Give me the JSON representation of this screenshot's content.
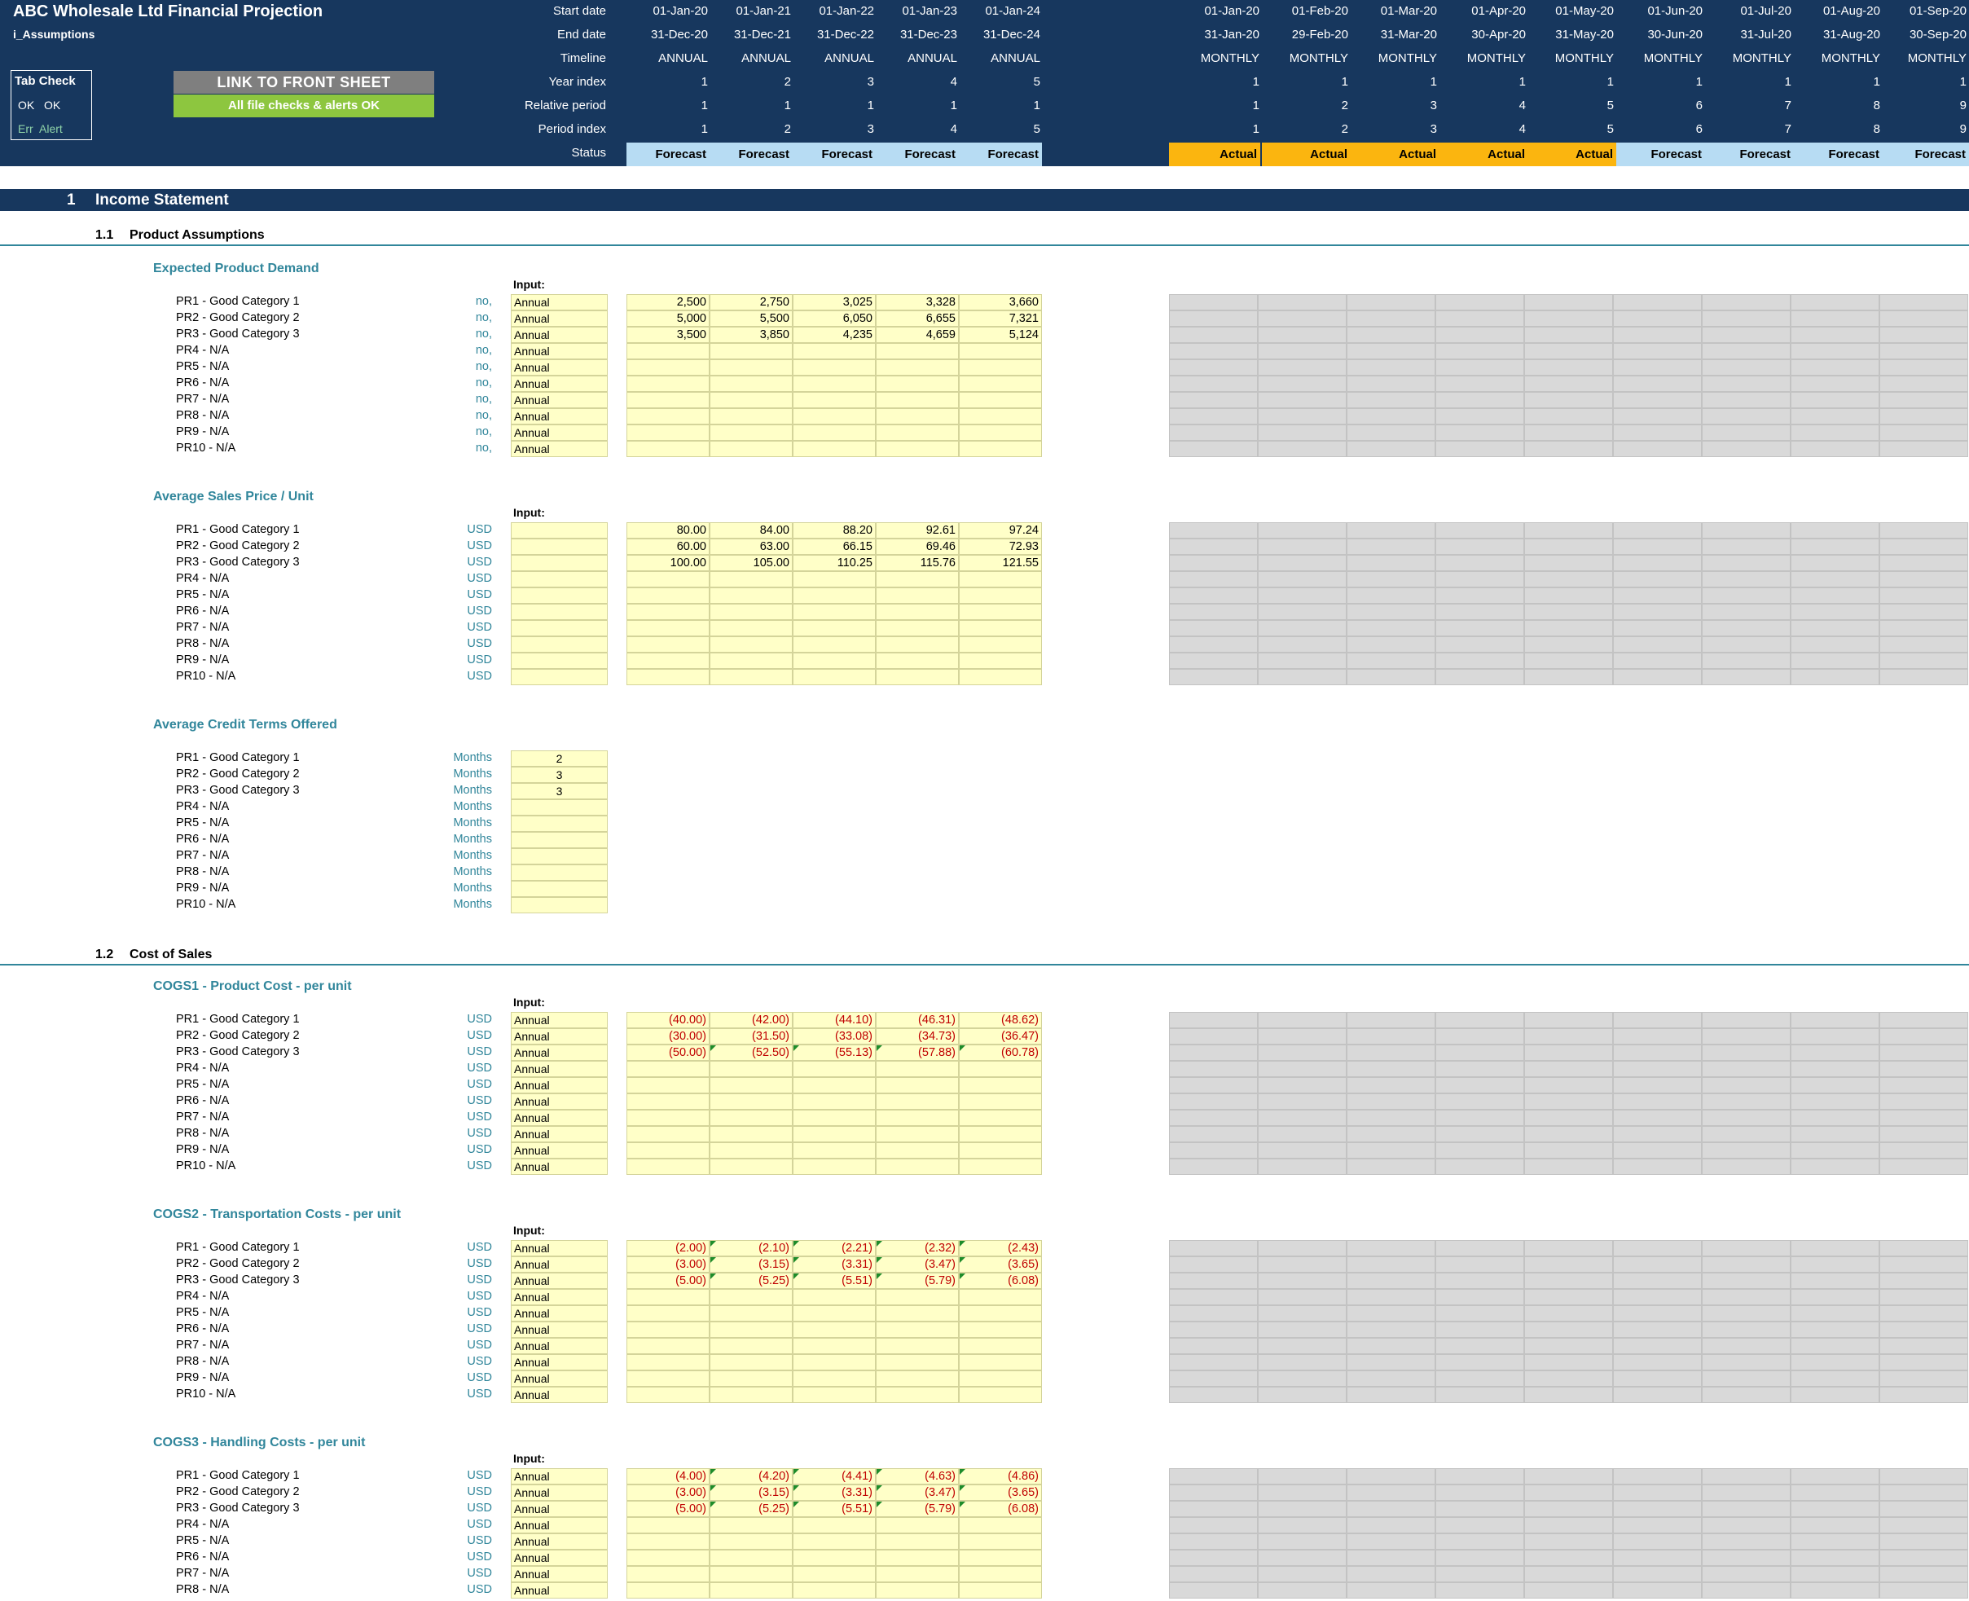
{
  "header": {
    "title": "ABC Wholesale Ltd Financial Projection",
    "sheet_name": "i_Assumptions",
    "tab_check": {
      "title": "Tab Check",
      "ok1": "OK",
      "ok2": "OK",
      "err": "Err",
      "alert": "Alert"
    },
    "link_button": "LINK TO FRONT SHEET",
    "file_checks": "All file checks & alerts OK",
    "row_labels": {
      "start": "Start date",
      "end": "End date",
      "timeline": "Timeline",
      "year_index": "Year index",
      "relative": "Relative period",
      "period_index": "Period index",
      "status": "Status"
    },
    "annual": {
      "start": [
        "01-Jan-20",
        "01-Jan-21",
        "01-Jan-22",
        "01-Jan-23",
        "01-Jan-24"
      ],
      "end": [
        "31-Dec-20",
        "31-Dec-21",
        "31-Dec-22",
        "31-Dec-23",
        "31-Dec-24"
      ],
      "timeline": [
        "ANNUAL",
        "ANNUAL",
        "ANNUAL",
        "ANNUAL",
        "ANNUAL"
      ],
      "year_index": [
        "1",
        "2",
        "3",
        "4",
        "5"
      ],
      "relative": [
        "1",
        "1",
        "1",
        "1",
        "1"
      ],
      "period_index": [
        "1",
        "2",
        "3",
        "4",
        "5"
      ],
      "status": [
        "Forecast",
        "Forecast",
        "Forecast",
        "Forecast",
        "Forecast"
      ]
    },
    "monthly": {
      "start": [
        "01-Jan-20",
        "01-Feb-20",
        "01-Mar-20",
        "01-Apr-20",
        "01-May-20",
        "01-Jun-20",
        "01-Jul-20",
        "01-Aug-20",
        "01-Sep-20"
      ],
      "end": [
        "31-Jan-20",
        "29-Feb-20",
        "31-Mar-20",
        "30-Apr-20",
        "31-May-20",
        "30-Jun-20",
        "31-Jul-20",
        "31-Aug-20",
        "30-Sep-20"
      ],
      "timeline": [
        "MONTHLY",
        "MONTHLY",
        "MONTHLY",
        "MONTHLY",
        "MONTHLY",
        "MONTHLY",
        "MONTHLY",
        "MONTHLY",
        "MONTHLY"
      ],
      "year_index": [
        "1",
        "1",
        "1",
        "1",
        "1",
        "1",
        "1",
        "1",
        "1"
      ],
      "relative": [
        "1",
        "2",
        "3",
        "4",
        "5",
        "6",
        "7",
        "8",
        "9"
      ],
      "period_index": [
        "1",
        "2",
        "3",
        "4",
        "5",
        "6",
        "7",
        "8",
        "9"
      ],
      "status": [
        "Actual",
        "Actual",
        "Actual",
        "Actual",
        "Actual",
        "Forecast",
        "Forecast",
        "Forecast",
        "Forecast"
      ]
    }
  },
  "section": {
    "number": "1",
    "title": "Income Statement"
  },
  "subsections": [
    {
      "number": "1.1",
      "title": "Product Assumptions"
    },
    {
      "number": "1.2",
      "title": "Cost of Sales"
    }
  ],
  "input_label": "Input:",
  "row_labels": [
    "PR1 - Good Category 1",
    "PR2 - Good Category 2",
    "PR3 - Good Category 3",
    "PR4 - N/A",
    "PR5 - N/A",
    "PR6 - N/A",
    "PR7 - N/A",
    "PR8 - N/A",
    "PR9 - N/A",
    "PR10 - N/A"
  ],
  "blocks": [
    {
      "title": "Expected Product Demand",
      "unit": "no,",
      "input": "Annual",
      "values": [
        [
          "2,500",
          "2,750",
          "3,025",
          "3,328",
          "3,660"
        ],
        [
          "5,000",
          "5,500",
          "6,050",
          "6,655",
          "7,321"
        ],
        [
          "3,500",
          "3,850",
          "4,235",
          "4,659",
          "5,124"
        ]
      ]
    },
    {
      "title": "Average Sales Price / Unit",
      "unit": "USD",
      "input": "",
      "values": [
        [
          "80.00",
          "84.00",
          "88.20",
          "92.61",
          "97.24"
        ],
        [
          "60.00",
          "63.00",
          "66.15",
          "69.46",
          "72.93"
        ],
        [
          "100.00",
          "105.00",
          "110.25",
          "115.76",
          "121.55"
        ]
      ]
    },
    {
      "title": "Average Credit Terms Offered",
      "unit": "Months",
      "credit_values": [
        "2",
        "3",
        "3"
      ]
    },
    {
      "title": "COGS1 - Product Cost - per unit",
      "unit": "USD",
      "input": "Annual",
      "values": [
        [
          "(40.00)",
          "(42.00)",
          "(44.10)",
          "(46.31)",
          "(48.62)"
        ],
        [
          "(30.00)",
          "(31.50)",
          "(33.08)",
          "(34.73)",
          "(36.47)"
        ],
        [
          "(50.00)",
          "(52.50)",
          "(55.13)",
          "(57.88)",
          "(60.78)"
        ]
      ]
    },
    {
      "title": "COGS2 - Transportation Costs - per unit",
      "unit": "USD",
      "input": "Annual",
      "values": [
        [
          "(2.00)",
          "(2.10)",
          "(2.21)",
          "(2.32)",
          "(2.43)"
        ],
        [
          "(3.00)",
          "(3.15)",
          "(3.31)",
          "(3.47)",
          "(3.65)"
        ],
        [
          "(5.00)",
          "(5.25)",
          "(5.51)",
          "(5.79)",
          "(6.08)"
        ]
      ]
    },
    {
      "title": "COGS3 - Handling Costs - per unit",
      "unit": "USD",
      "input": "Annual",
      "values": [
        [
          "(4.00)",
          "(4.20)",
          "(4.41)",
          "(4.63)",
          "(4.86)"
        ],
        [
          "(3.00)",
          "(3.15)",
          "(3.31)",
          "(3.47)",
          "(3.65)"
        ],
        [
          "(5.00)",
          "(5.25)",
          "(5.51)",
          "(5.79)",
          "(6.08)"
        ]
      ]
    }
  ]
}
